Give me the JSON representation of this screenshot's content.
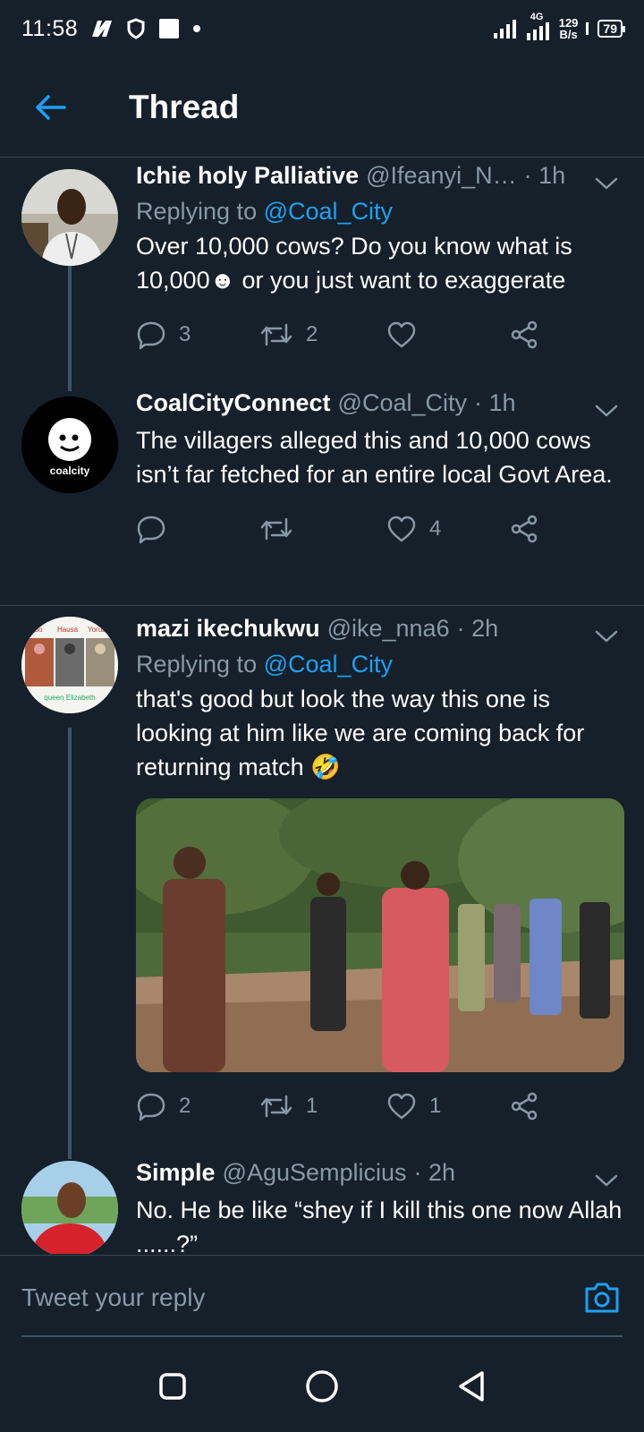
{
  "status_bar": {
    "time": "11:58",
    "network_type": "4G",
    "speed_value": "129",
    "speed_unit": "B/s",
    "battery": "79"
  },
  "header": {
    "title": "Thread"
  },
  "tweets": [
    {
      "name": "Ichie holy Palliative",
      "handle": "@Ifeanyi_N…",
      "time": "· 1h",
      "replying_label": "Replying to",
      "replying_to": "@Coal_City",
      "text": "Over 10,000 cows? Do you know what is 10,000☻ or you just want to exaggerate",
      "reply_count": "3",
      "retweet_count": "2",
      "like_count": ""
    },
    {
      "name": "CoalCityConnect",
      "handle": "@Coal_City",
      "time": "· 1h",
      "text": "The villagers alleged this and 10,000 cows isn’t far fetched for an entire local Govt Area.",
      "avatar_text": "coalcity",
      "reply_count": "",
      "retweet_count": "",
      "like_count": "4"
    },
    {
      "name": "mazi ikechukwu",
      "handle": "@ike_nna6",
      "time": "· 2h",
      "replying_label": "Replying to",
      "replying_to": "@Coal_City",
      "text": "that's good but look the way this one is looking at him like we are coming back for returning match 🤣",
      "avatar_labels": [
        "Igbo",
        "Hausa",
        "Yoruba",
        "queen Elizabeth"
      ],
      "reply_count": "2",
      "retweet_count": "1",
      "like_count": "1"
    },
    {
      "name": "Simple",
      "handle": "@AguSemplicius",
      "time": "· 2h",
      "text": "No. He be like “shey if I kill this one now Allah ......?”"
    }
  ],
  "composer": {
    "placeholder": "Tweet your reply"
  },
  "colors": {
    "background": "#15202b",
    "accent": "#1da1f2",
    "secondary_text": "#8899a6",
    "divider": "#38444d"
  }
}
